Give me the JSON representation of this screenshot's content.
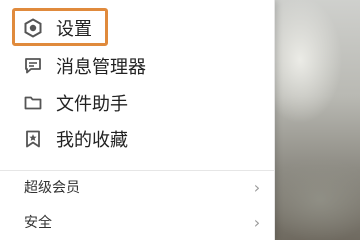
{
  "menu": {
    "items": [
      {
        "label": "设置",
        "icon": "hexagon-settings-icon"
      },
      {
        "label": "消息管理器",
        "icon": "message-icon"
      },
      {
        "label": "文件助手",
        "icon": "folder-icon"
      },
      {
        "label": "我的收藏",
        "icon": "bookmark-star-icon"
      }
    ],
    "sub_items": [
      {
        "label": "超级会员",
        "icon": "chevron-right-icon"
      },
      {
        "label": "安全",
        "icon": "chevron-right-icon"
      }
    ],
    "highlight_color": "#e08a3c"
  }
}
